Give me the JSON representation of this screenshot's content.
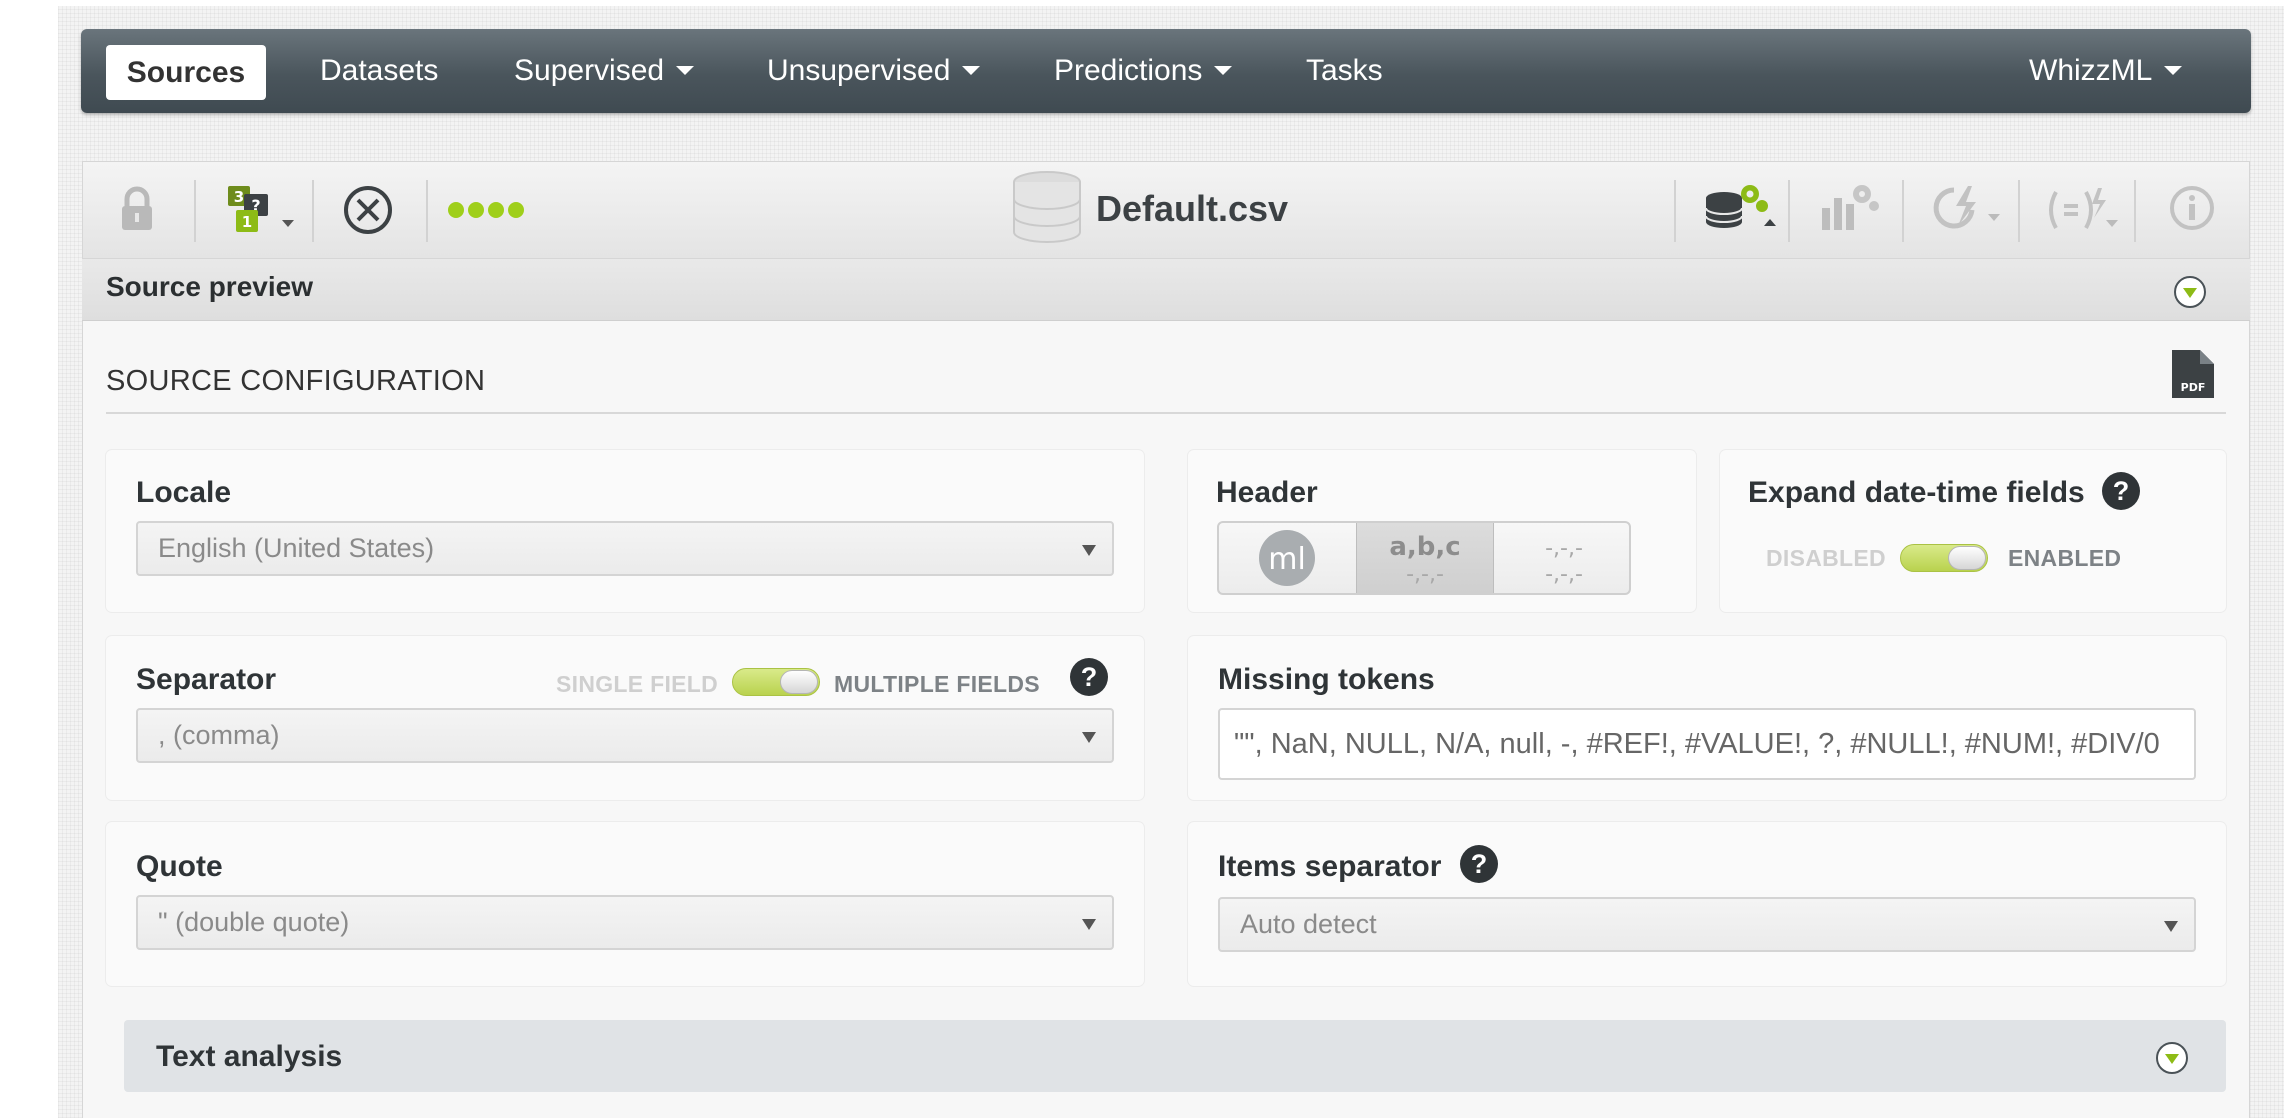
{
  "nav": {
    "items": [
      {
        "label": "Sources",
        "active": true,
        "has_caret": false
      },
      {
        "label": "Datasets",
        "has_caret": false
      },
      {
        "label": "Supervised",
        "has_caret": true
      },
      {
        "label": "Unsupervised",
        "has_caret": true
      },
      {
        "label": "Predictions",
        "has_caret": true
      },
      {
        "label": "Tasks",
        "has_caret": false
      }
    ],
    "right_menu": {
      "label": "WhizzML",
      "has_caret": true
    }
  },
  "toolbar": {
    "file_name": "Default.csv",
    "left_icons": [
      "lock-icon",
      "field-types-icon",
      "cancel-icon",
      "progress-dots-icon"
    ],
    "right_icons": [
      "dataset-config-icon",
      "model-icon",
      "batch-icon",
      "formula-icon",
      "info-icon"
    ]
  },
  "preview": {
    "title": "Source preview"
  },
  "config": {
    "title": "SOURCE CONFIGURATION",
    "pdf_badge": "PDF",
    "locale": {
      "label": "Locale",
      "value": "English (United States)"
    },
    "header": {
      "label": "Header",
      "options": [
        "ml",
        "a,b,c",
        "-,-,-"
      ],
      "selected": "a,b,c"
    },
    "expand_datetime": {
      "label": "Expand date-time fields",
      "help": "?",
      "off_label": "DISABLED",
      "on_label": "ENABLED"
    },
    "separator": {
      "label": "Separator",
      "off_label": "SINGLE FIELD",
      "on_label": "MULTIPLE FIELDS",
      "help": "?",
      "value": ", (comma)"
    },
    "missing_tokens": {
      "label": "Missing tokens",
      "value": "\"\", NaN, NULL, N/A, null, -, #REF!, #VALUE!, ?, #NULL!, #NUM!, #DIV/0"
    },
    "quote": {
      "label": "Quote",
      "value": "\" (double quote)"
    },
    "items_separator": {
      "label": "Items separator",
      "help": "?",
      "value": "Auto detect"
    },
    "text_analysis": {
      "label": "Text analysis"
    }
  },
  "colors": {
    "accent": "#8dbb16",
    "nav_bg": "#4a555c",
    "text_dark": "#2f3437"
  }
}
